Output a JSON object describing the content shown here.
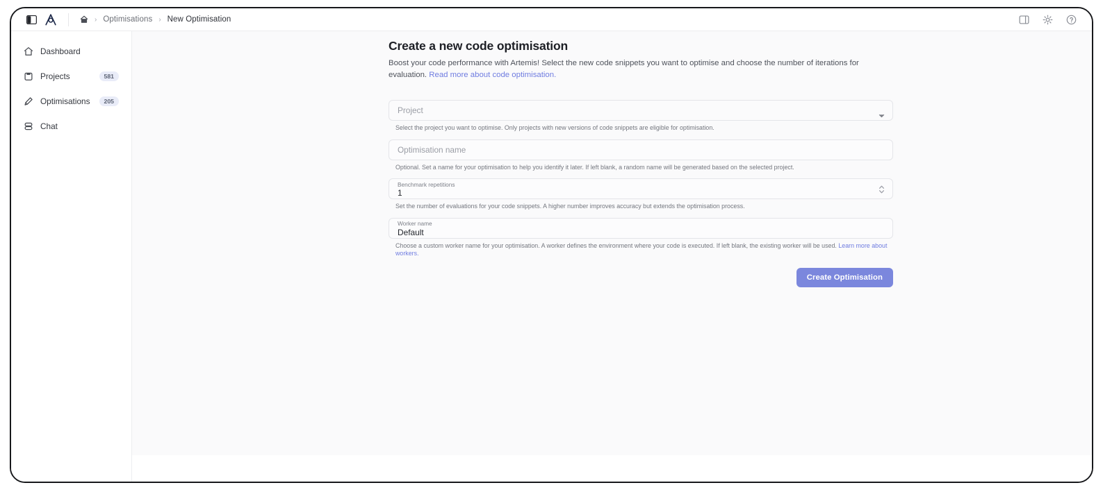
{
  "app": {
    "logo_icon": "artemis-a-logo",
    "panel_toggle_icon": "panel-toggle-icon"
  },
  "breadcrumb": {
    "home_icon": "home-icon",
    "separator": "›",
    "items": [
      {
        "label": "Optimisations"
      },
      {
        "label": "New Optimisation"
      }
    ]
  },
  "topbar_actions": [
    {
      "name": "panel-layout-icon",
      "icon": "panel-layout-icon"
    },
    {
      "name": "settings-gear-icon",
      "icon": "gear-icon"
    },
    {
      "name": "help-circle-icon",
      "icon": "help-icon"
    }
  ],
  "sidebar": {
    "items": [
      {
        "label": "Dashboard",
        "icon": "home-icon",
        "badge": ""
      },
      {
        "label": "Projects",
        "icon": "clipboard-icon",
        "badge": "581"
      },
      {
        "label": "Optimisations",
        "icon": "pencil-icon",
        "badge": "205"
      },
      {
        "label": "Chat",
        "icon": "chat-icon",
        "badge": ""
      }
    ]
  },
  "main": {
    "title": "Create a new code optimisation",
    "description": "Boost your code performance with Artemis! Select the new code snippets you want to optimise and choose the number of iterations for evaluation. ",
    "description_link": "Read more about code optimisation.",
    "fields": {
      "project": {
        "placeholder": "Project",
        "helper": "Select the project you want to optimise. Only projects with new versions of code snippets are eligible for optimisation."
      },
      "optimisation_name": {
        "placeholder": "Optimisation name",
        "helper": "Optional. Set a name for your optimisation to help you identify it later. If left blank, a random name will be generated based on the selected project."
      },
      "benchmark_repetitions": {
        "label": "Benchmark repetitions",
        "value": "1",
        "helper": "Set the number of evaluations for your code snippets. A higher number improves accuracy but extends the optimisation process."
      },
      "worker_name": {
        "label": "Worker name",
        "value": "Default",
        "helper": "Choose a custom worker name for your optimisation. A worker defines the environment where your code is executed. If left blank, the existing worker will be used. ",
        "helper_link": "Learn more about workers."
      }
    },
    "submit_label": "Create Optimisation"
  },
  "colors": {
    "accent": "#7b87dd",
    "link": "#6f7ce0",
    "badge_bg": "#e9ecf8",
    "content_bg": "#fafafb"
  }
}
